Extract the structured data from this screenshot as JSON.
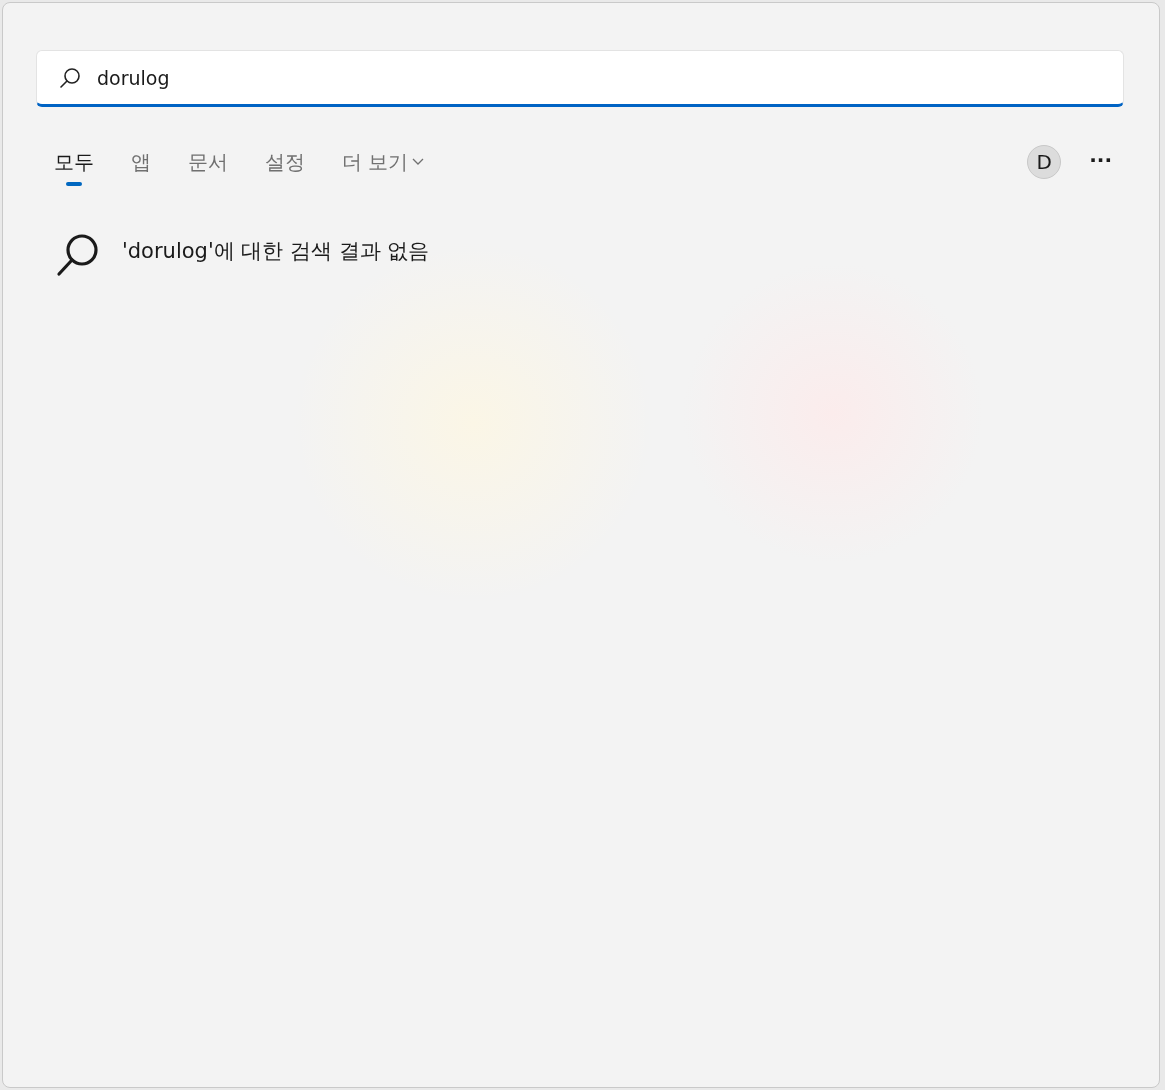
{
  "search": {
    "value": "dorulog"
  },
  "tabs": [
    {
      "label": "모두",
      "selected": true,
      "kind": "tab"
    },
    {
      "label": "앱",
      "selected": false,
      "kind": "tab"
    },
    {
      "label": "문서",
      "selected": false,
      "kind": "tab"
    },
    {
      "label": "설정",
      "selected": false,
      "kind": "tab"
    },
    {
      "label": "더 보기",
      "selected": false,
      "kind": "dropdown"
    }
  ],
  "account": {
    "initial": "D"
  },
  "more_button": {
    "label": "···"
  },
  "result": {
    "message": "'dorulog'에 대한 검색 결과 없음"
  }
}
